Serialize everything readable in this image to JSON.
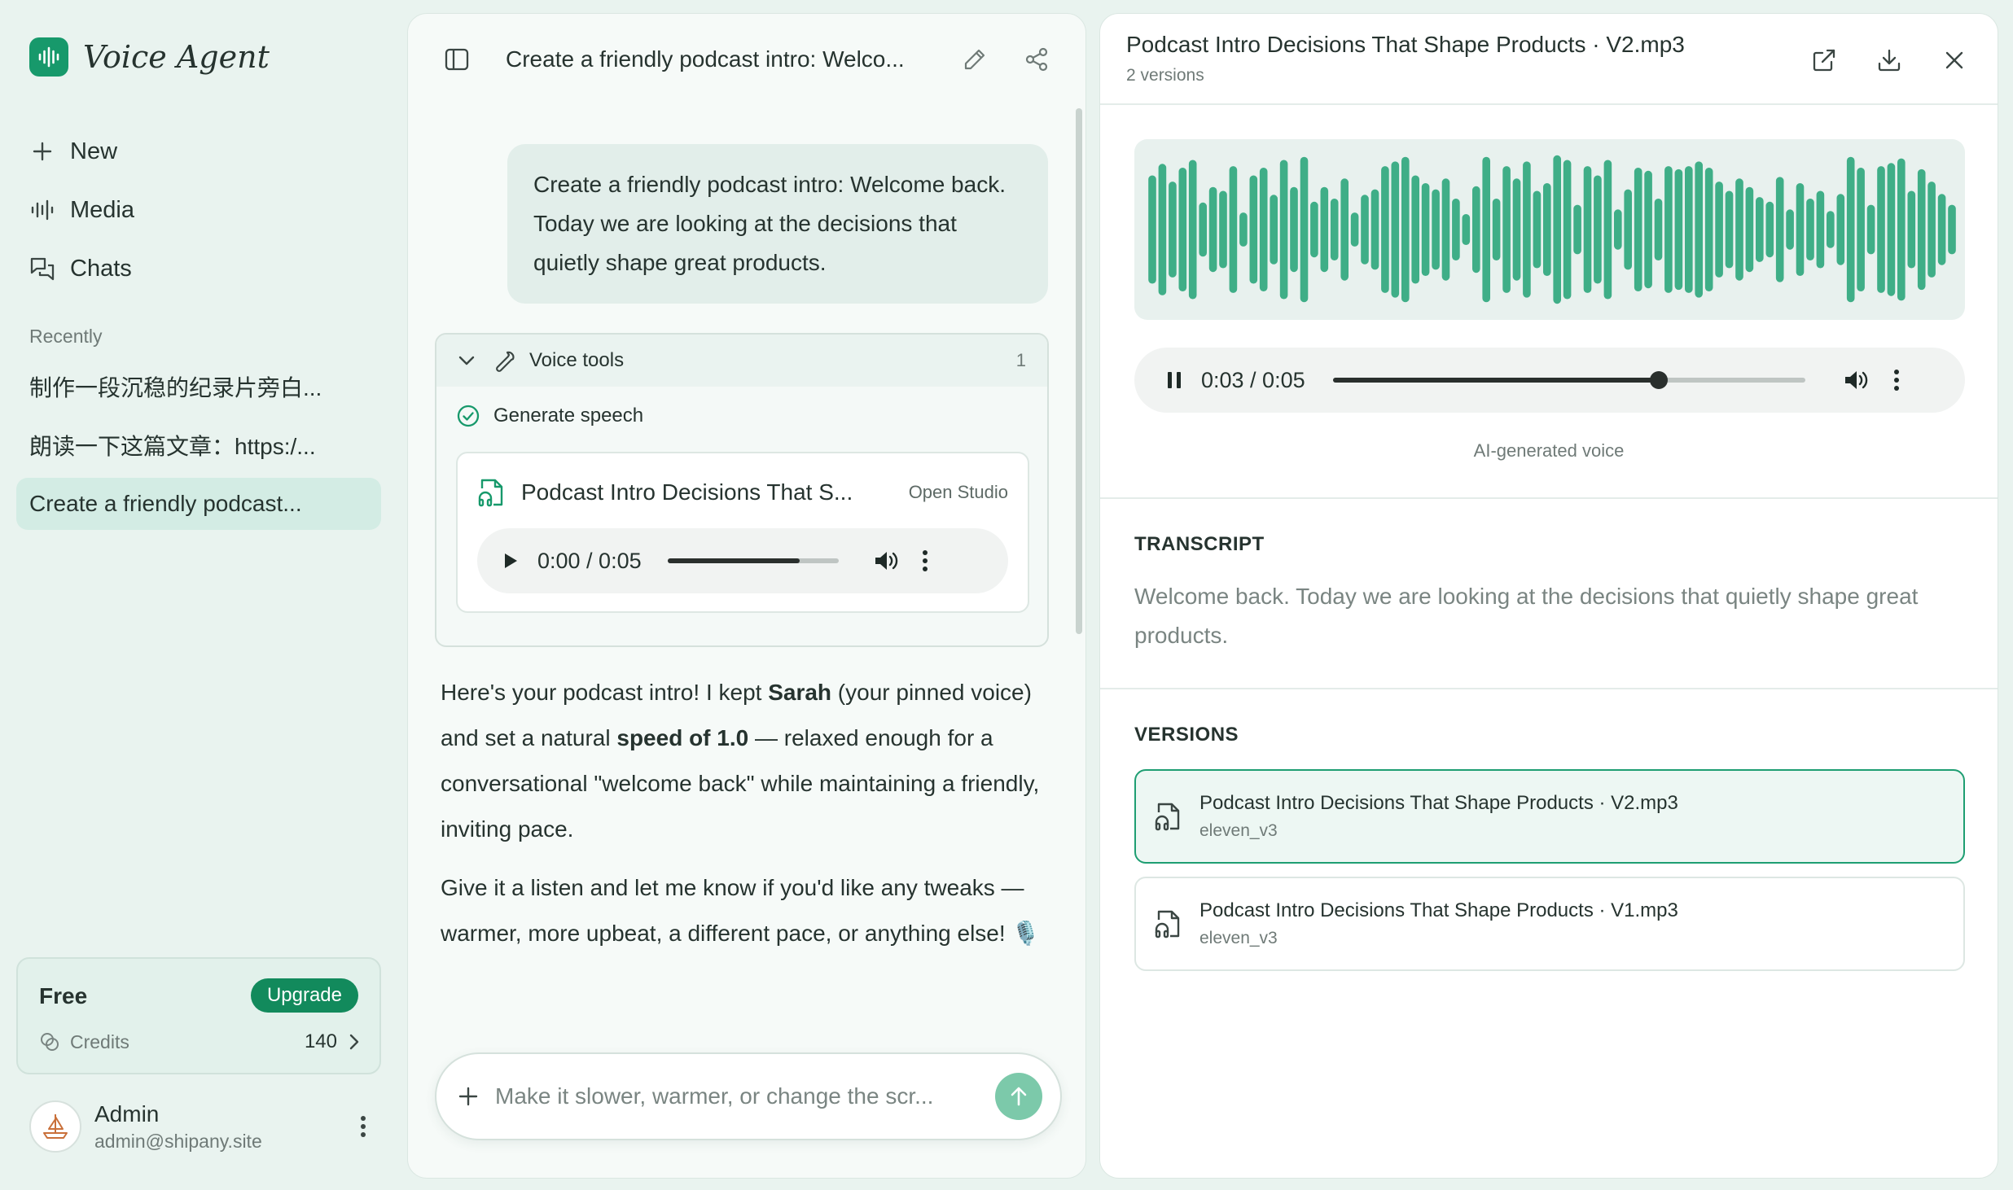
{
  "brand": {
    "name": "Voice Agent"
  },
  "nav": {
    "new_label": "New",
    "media_label": "Media",
    "chats_label": "Chats"
  },
  "recent": {
    "title": "Recently",
    "items": [
      {
        "label": "制作一段沉稳的纪录片旁白..."
      },
      {
        "label": "朗读一下这篇文章：https:/..."
      },
      {
        "label": "Create a friendly podcast..."
      }
    ]
  },
  "plan": {
    "name": "Free",
    "upgrade_label": "Upgrade",
    "credits_label": "Credits",
    "credits_value": "140"
  },
  "user": {
    "name": "Admin",
    "email": "admin@shipany.site"
  },
  "chat": {
    "title": "Create a friendly podcast intro: Welco...",
    "user_message": "Create a friendly podcast intro: Welcome back. Today we are looking at the decisions that quietly shape great products.",
    "tool": {
      "name": "Voice tools",
      "count": "1",
      "step_label": "Generate speech",
      "file_name": "Podcast Intro Decisions That S...",
      "open_label": "Open Studio",
      "time": "0:00 / 0:05",
      "progress": 0.77
    },
    "answer": {
      "p1_a": "Here's your podcast intro! I kept ",
      "p1_b": "Sarah",
      "p1_c": " (your pinned voice) and set a natural ",
      "p1_d": "speed of 1.0",
      "p1_e": " — relaxed enough for a conversational \"welcome back\" while maintaining a friendly, inviting pace.",
      "p2": "Give it a listen and let me know if you'd like any tweaks — warmer, more upbeat, a different pace, or anything else! 🎙️"
    },
    "composer_placeholder": "Make it slower, warmer, or change the scr..."
  },
  "detail": {
    "title": "Podcast Intro Decisions That Shape Products · V2.mp3",
    "subtitle": "2 versions",
    "time": "0:03 / 0:05",
    "progress": 0.69,
    "ai_label": "AI-generated voice",
    "transcript_title": "TRANSCRIPT",
    "transcript": "Welcome back. Today we are looking at the decisions that quietly shape great products.",
    "versions_title": "VERSIONS",
    "versions": [
      {
        "name": "Podcast Intro Decisions That Shape Products · V2.mp3",
        "model": "eleven_v3",
        "active": true
      },
      {
        "name": "Podcast Intro Decisions That Shape Products · V1.mp3",
        "model": "eleven_v3",
        "active": false
      }
    ],
    "waveform": [
      0.7,
      0.85,
      0.62,
      0.8,
      0.9,
      0.35,
      0.55,
      0.5,
      0.82,
      0.22,
      0.7,
      0.8,
      0.45,
      0.9,
      0.55,
      0.94,
      0.36,
      0.55,
      0.4,
      0.66,
      0.22,
      0.45,
      0.52,
      0.82,
      0.88,
      0.94,
      0.7,
      0.6,
      0.52,
      0.66,
      0.4,
      0.2,
      0.56,
      0.94,
      0.4,
      0.82,
      0.66,
      0.88,
      0.5,
      0.6,
      0.96,
      0.9,
      0.32,
      0.82,
      0.7,
      0.9,
      0.26,
      0.52,
      0.8,
      0.76,
      0.4,
      0.82,
      0.78,
      0.82,
      0.88,
      0.8,
      0.62,
      0.5,
      0.66,
      0.55,
      0.42,
      0.36,
      0.68,
      0.26,
      0.6,
      0.4,
      0.5,
      0.24,
      0.46,
      0.94,
      0.8,
      0.32,
      0.82,
      0.86,
      0.92,
      0.5,
      0.78,
      0.62,
      0.46,
      0.32
    ],
    "colors": {
      "accent": "#17996b",
      "wave": "#3fae87"
    }
  }
}
